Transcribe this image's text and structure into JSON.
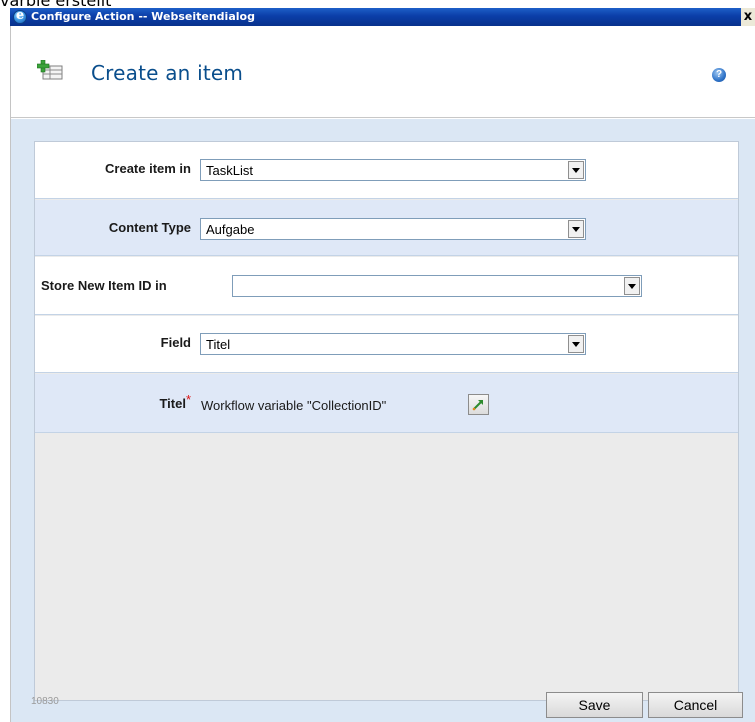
{
  "background_text": "varble erstellt",
  "window": {
    "title": "Configure Action -- Webseitendialog",
    "close_label": "x"
  },
  "header": {
    "title": "Create an item"
  },
  "form": {
    "create_item_in": {
      "label": "Create item in",
      "value": "TaskList"
    },
    "content_type": {
      "label": "Content Type",
      "value": "Aufgabe"
    },
    "store_id": {
      "label": "Store New Item ID in",
      "value": ""
    },
    "field": {
      "label": "Field",
      "value": "Titel"
    },
    "titel_row": {
      "label": "Titel",
      "required_mark": "*",
      "value_text": "Workflow variable \"CollectionID\""
    }
  },
  "footer": {
    "id_text": "10830",
    "save_label": "Save",
    "cancel_label": "Cancel"
  }
}
